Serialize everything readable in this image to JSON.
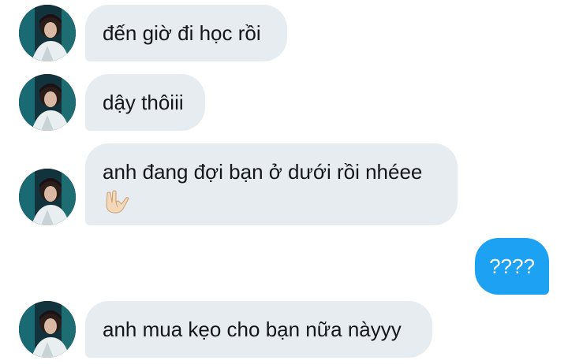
{
  "conversation": {
    "messages": [
      {
        "direction": "incoming",
        "text": "đến giờ đi học rồi"
      },
      {
        "direction": "incoming",
        "text": "dậy thôiii"
      },
      {
        "direction": "incoming",
        "text": "anh đang đợi bạn ở dưới rồi nhéee",
        "emoji": "love-you-gesture-hand-icon"
      },
      {
        "direction": "outgoing",
        "text": "????"
      },
      {
        "direction": "incoming",
        "text": "anh mua kẹo cho bạn nữa nàyyy"
      }
    ],
    "colors": {
      "incoming_bubble": "#e6ecf0",
      "outgoing_bubble": "#1da1f2",
      "text_dark": "#14171a",
      "text_light": "#ffffff"
    }
  }
}
